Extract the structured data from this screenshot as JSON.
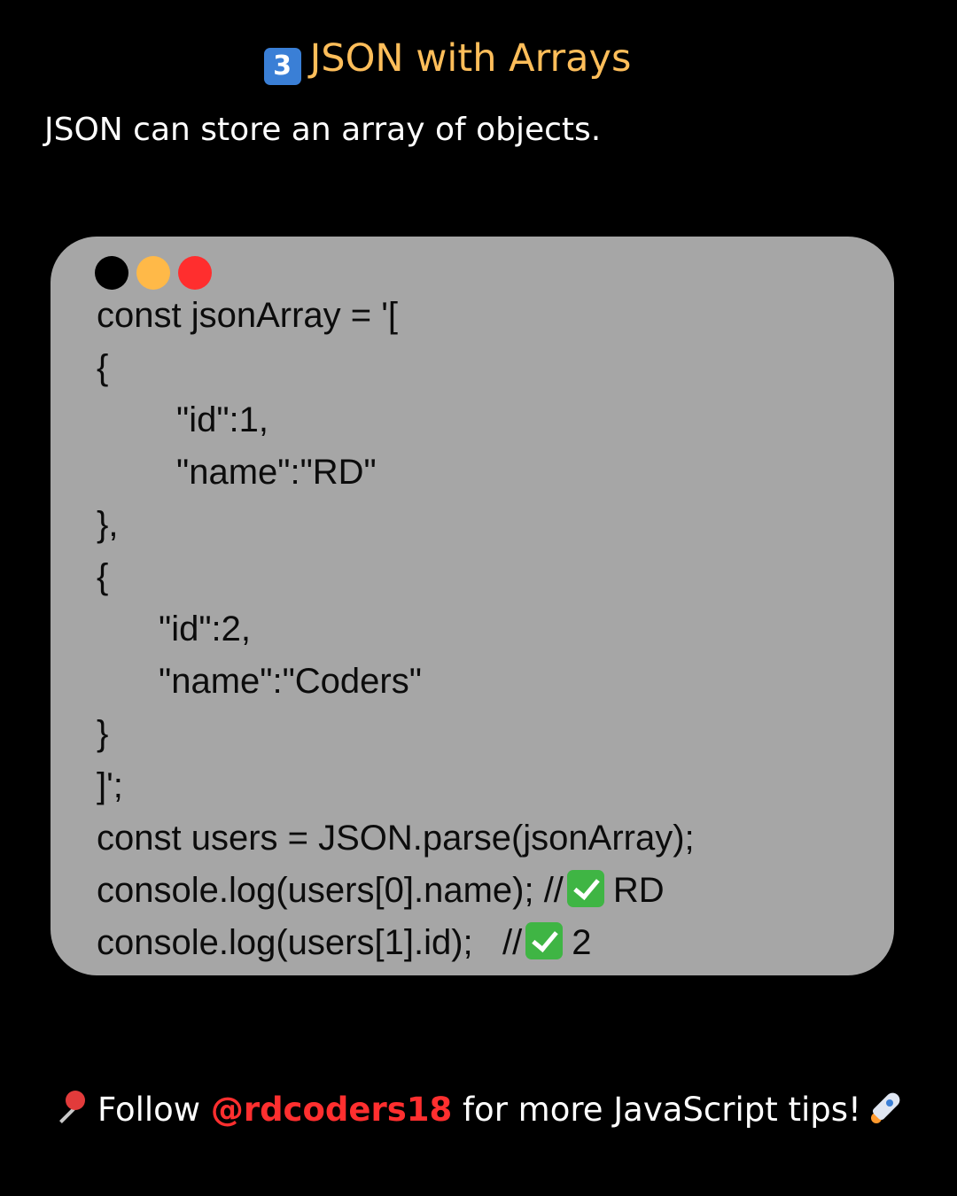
{
  "header": {
    "badge": "3",
    "title": "JSON with Arrays",
    "subtitle": "JSON can store an array of objects."
  },
  "code_window": {
    "dot_colors": [
      "#000000",
      "#ffb948",
      "#ff2e2e"
    ],
    "lines": [
      "const jsonArray = '[",
      "{",
      "\"id\":1,",
      "\"name\":\"RD\"",
      "},",
      "{",
      "\"id\":2,",
      "\"name\":\"Coders\"",
      "}",
      "]';",
      "const users = JSON.parse(jsonArray);",
      "console.log(users[0].name); //",
      "RD",
      "console.log(users[1].id);   //",
      "2"
    ]
  },
  "footer": {
    "follow": "Follow",
    "handle": "@rdcoders18",
    "rest": "for more JavaScript tips!",
    "handle_color": "#ff2f2f"
  },
  "icons": {
    "title_badge": "keycap-3-icon",
    "check": "check-mark-icon",
    "pin": "pushpin-icon",
    "rocket": "rocket-icon"
  }
}
